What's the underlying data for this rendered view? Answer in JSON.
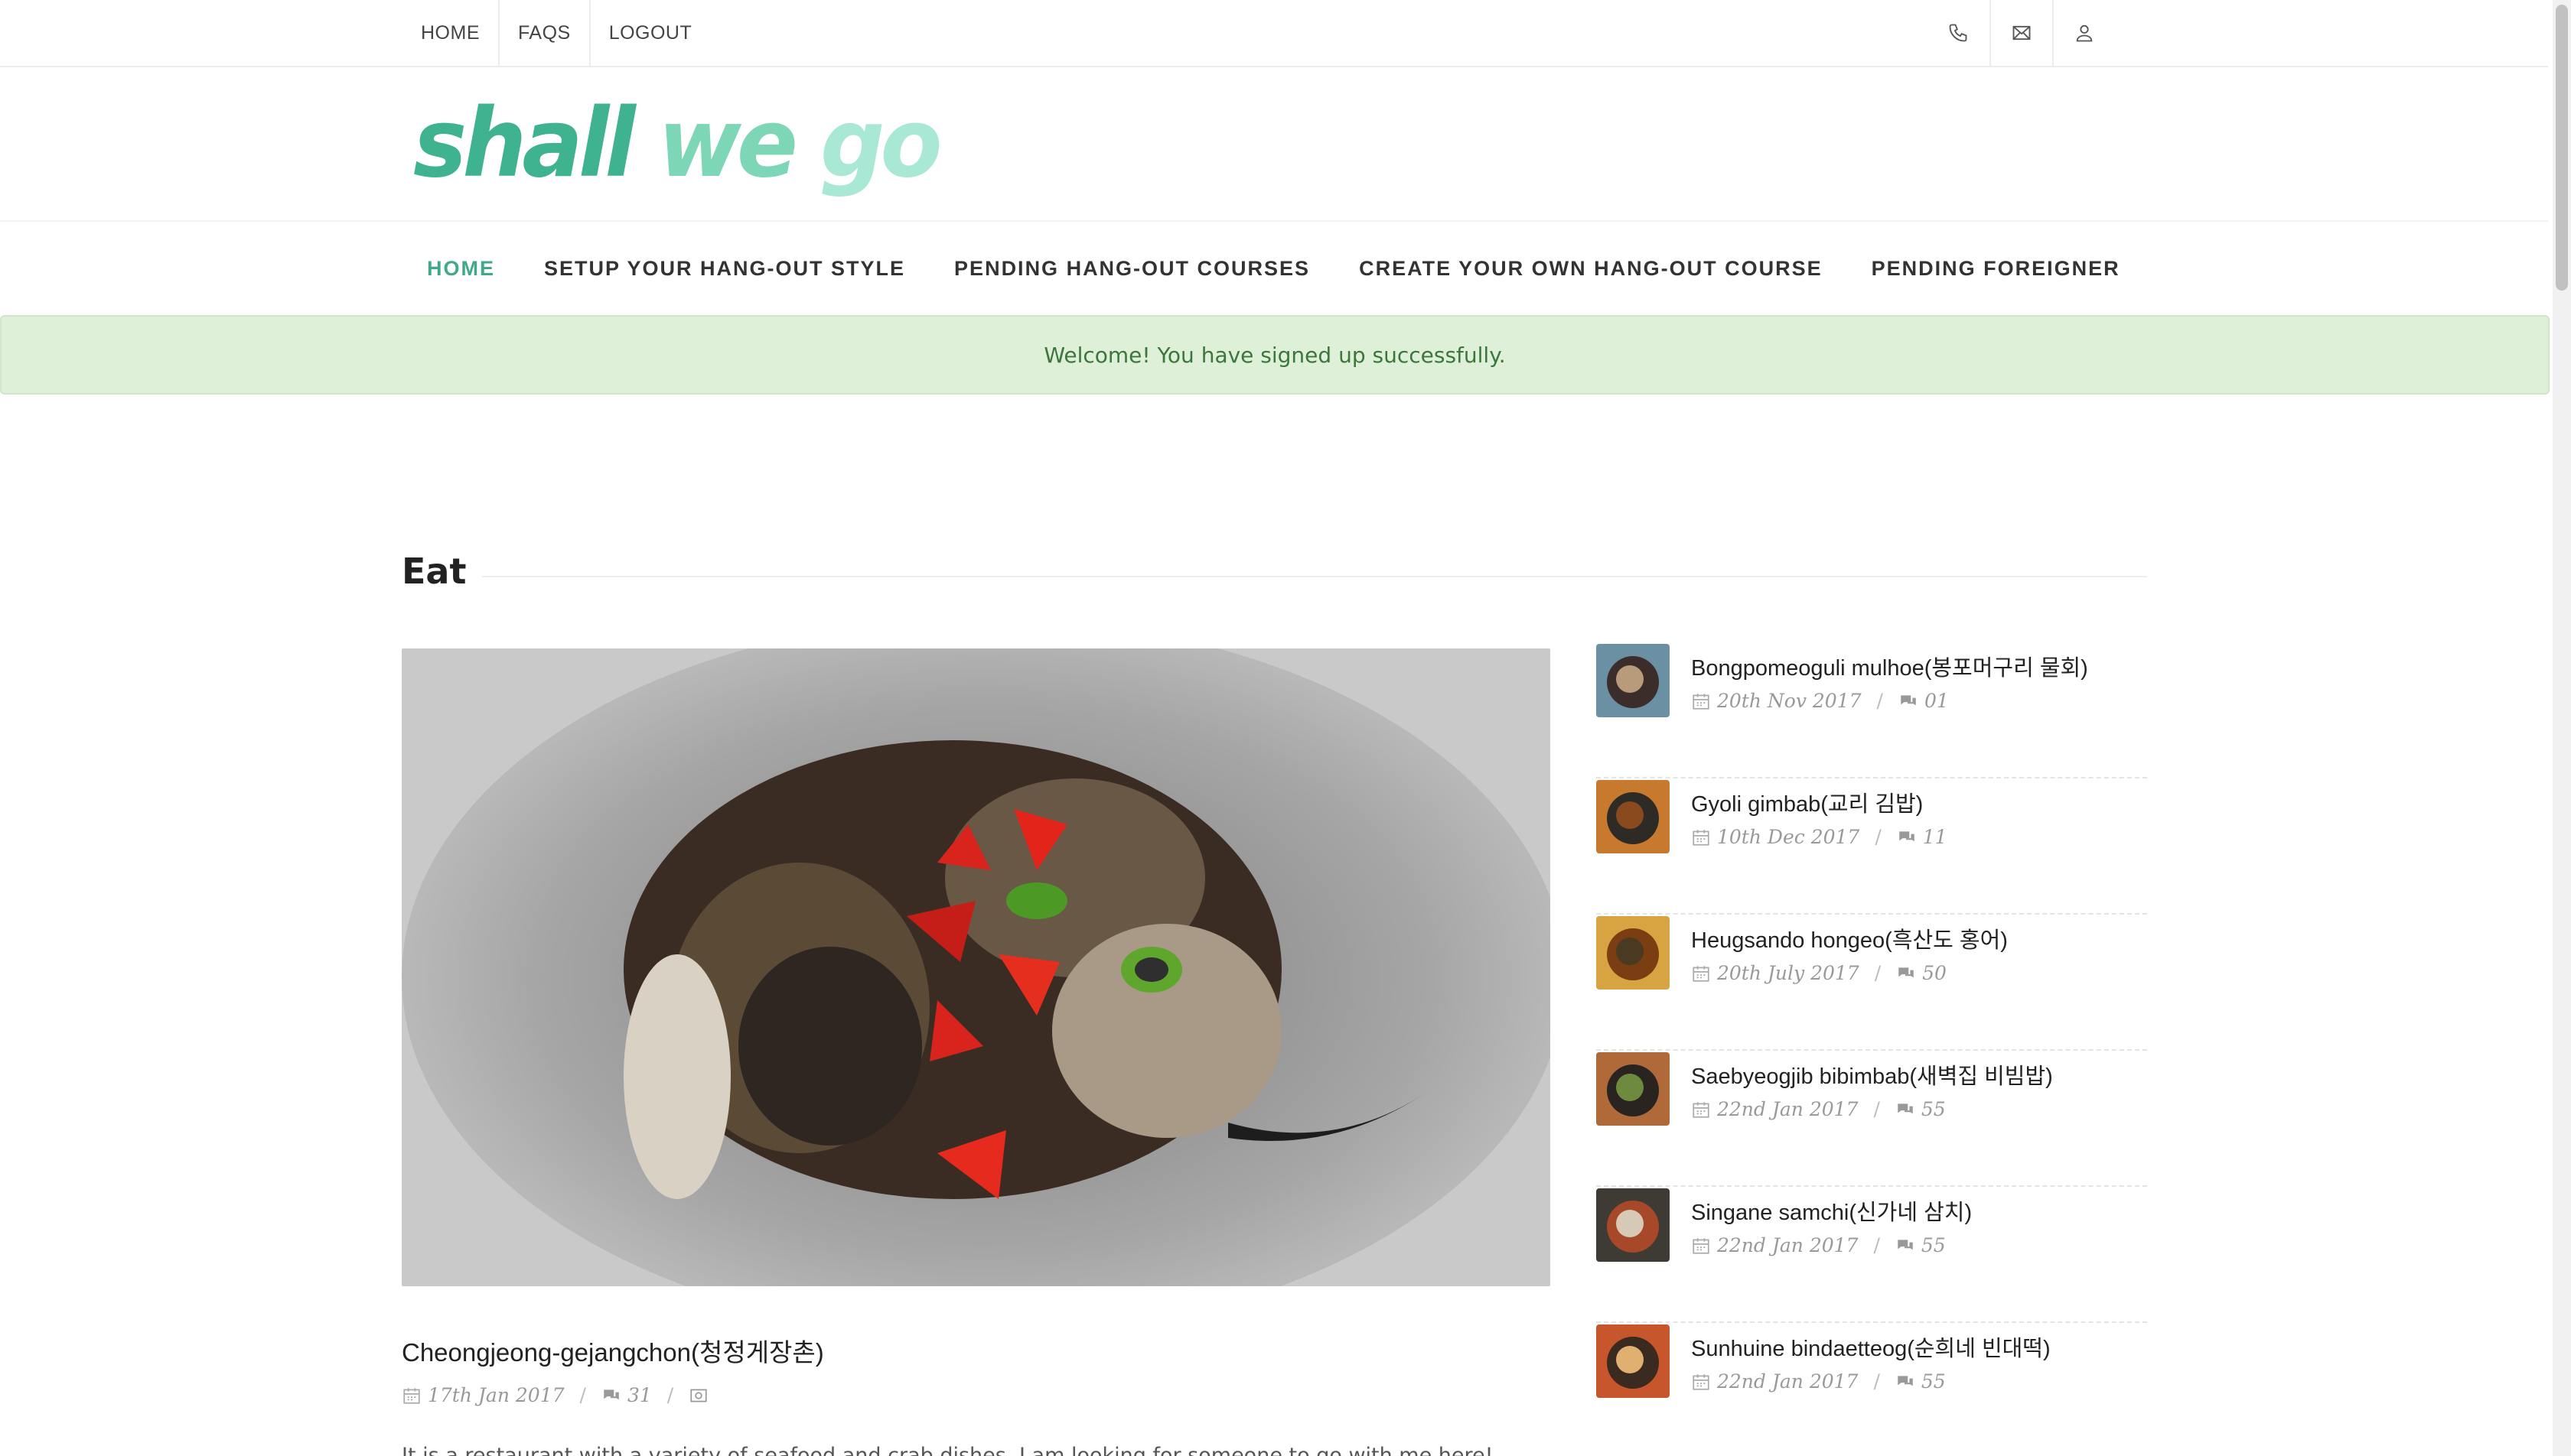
{
  "topnav": [
    "HOME",
    "FAQS",
    "LOGOUT"
  ],
  "logo": {
    "w1": "shall",
    "w2": "we",
    "w3": "go"
  },
  "mainnav": {
    "items": [
      "HOME",
      "SETUP YOUR HANG-OUT STYLE",
      "PENDING HANG-OUT COURSES",
      "CREATE YOUR OWN HANG-OUT COURSE",
      "PENDING FOREIGNER"
    ],
    "active": "HOME"
  },
  "alert": "Welcome! You have signed up successfully.",
  "section": {
    "title": "Eat"
  },
  "featured": {
    "title": "Cheongjeong-gejangchon(청정게장촌)",
    "date": "17th Jan 2017",
    "comments": "31",
    "excerpt": "It is a restaurant with a variety of seafood and crab dishes. I am looking for someone to go with me here!"
  },
  "sidebar": [
    {
      "title": "Bongpomeoguli mulhoe(봉포머구리 물회)",
      "date": "20th Nov 2017",
      "comments": "01"
    },
    {
      "title": "Gyoli gimbab(교리 김밥)",
      "date": "10th Dec 2017",
      "comments": "11"
    },
    {
      "title": "Heugsando hongeo(흑산도 홍어)",
      "date": "20th July 2017",
      "comments": "50"
    },
    {
      "title": "Saebyeogjib bibimbab(새벽집 비빔밥)",
      "date": "22nd Jan 2017",
      "comments": "55"
    },
    {
      "title": "Singane samchi(신가네 삼치)",
      "date": "22nd Jan 2017",
      "comments": "55"
    },
    {
      "title": "Sunhuine bindaetteog(순희네 빈대떡)",
      "date": "22nd Jan 2017",
      "comments": "55"
    }
  ],
  "colors": {
    "accent": "#3fa98a",
    "alert_bg": "#dff0d8",
    "alert_text": "#3c763d"
  },
  "icons": [
    "phone-icon",
    "mail-icon",
    "user-icon",
    "calendar-icon",
    "comment-icon",
    "image-icon"
  ]
}
